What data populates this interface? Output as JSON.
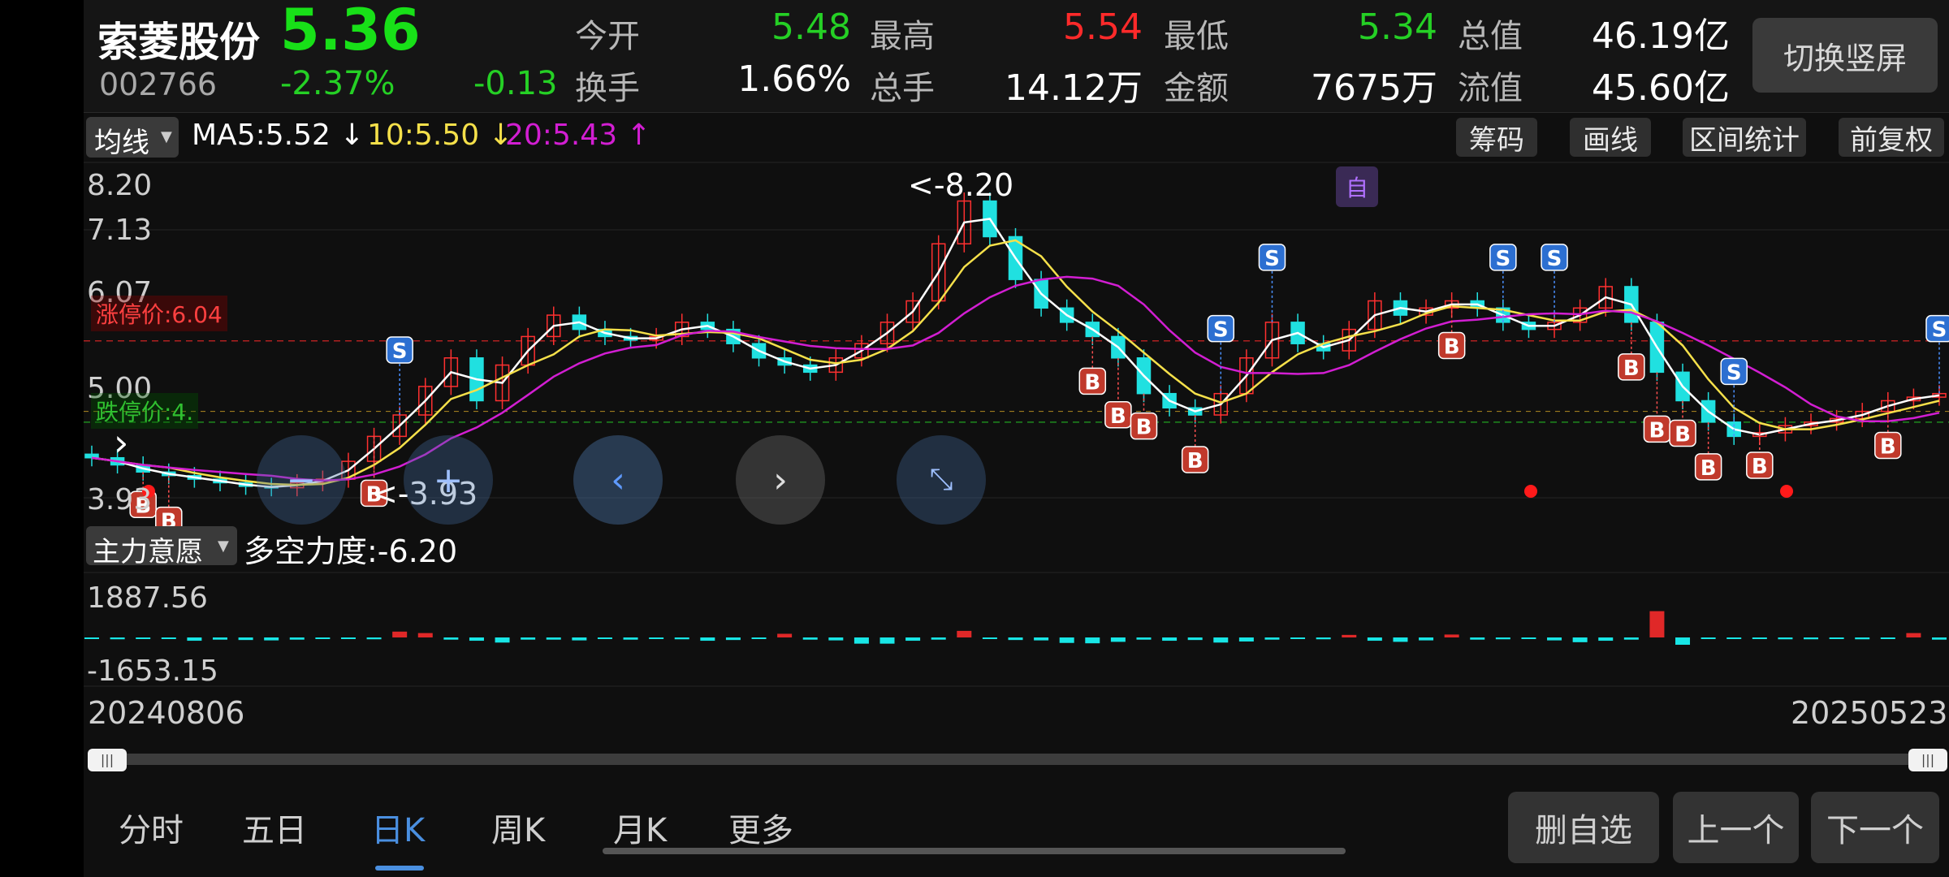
{
  "header": {
    "stock_name": "索菱股份",
    "price": "5.36",
    "code": "002766",
    "change_pct": "-2.37%",
    "change": "-0.13",
    "stats": [
      {
        "label": "今开",
        "value": "5.48",
        "color": "#25d025"
      },
      {
        "label": "最高",
        "value": "5.54",
        "color": "#ff2a2a"
      },
      {
        "label": "最低",
        "value": "5.34",
        "color": "#25d025"
      },
      {
        "label": "总值",
        "value": "46.19亿",
        "color": "#ffffff"
      },
      {
        "label": "换手",
        "value": "1.66%",
        "color": "#ffffff"
      },
      {
        "label": "总手",
        "value": "14.12万",
        "color": "#ffffff"
      },
      {
        "label": "金额",
        "value": "7675万",
        "color": "#ffffff"
      },
      {
        "label": "流值",
        "value": "45.60亿",
        "color": "#ffffff"
      }
    ],
    "switch_button": "切换竖屏"
  },
  "ma_bar": {
    "selector": "均线",
    "ma5": "MA5:5.52",
    "ma10": "10:5.50",
    "ma20": "20:5.43",
    "ma5_color": "#ffffff",
    "ma10_color": "#f5e04a",
    "ma20_color": "#d21ed2",
    "ma5_trend": "down-arrow",
    "ma10_trend": "down-arrow",
    "ma20_trend": "up-arrow"
  },
  "tools": [
    "筹码",
    "画线",
    "区间统计",
    "前复权"
  ],
  "price_axis": [
    "8.20",
    "7.13",
    "6.07",
    "5.00",
    "3.93"
  ],
  "limit_up_label": "涨停价:6.04",
  "limit_down_label": "跌停价:4.",
  "high_marker": "8.20",
  "low_marker": "3.93",
  "custom_marker": "自",
  "indicator": {
    "selector": "主力意愿",
    "title": "多空力度:-6.20",
    "axis_top": "1887.56",
    "axis_bottom": "-1653.15"
  },
  "date_start": "20240806",
  "date_end": "20250523",
  "nav_tabs": [
    "分时",
    "五日",
    "日K",
    "周K",
    "月K",
    "更多"
  ],
  "active_tab": 2,
  "bottom_buttons": [
    "删自选",
    "上一个",
    "下一个"
  ],
  "chart_data": {
    "type": "candlestick",
    "date_range": [
      "20240806",
      "20250523"
    ],
    "ylim": [
      3.93,
      8.2
    ],
    "y_ticks": [
      8.2,
      7.13,
      6.07,
      5.0,
      3.93
    ],
    "limit_up": 6.04,
    "ma": {
      "MA5": 5.52,
      "MA10": 5.5,
      "MA20": 5.43
    },
    "close": [
      4.4,
      4.3,
      4.2,
      4.15,
      4.1,
      4.05,
      4.0,
      3.98,
      4.05,
      4.1,
      4.35,
      4.7,
      5.0,
      5.4,
      5.8,
      5.2,
      5.7,
      6.1,
      6.4,
      6.2,
      6.1,
      6.05,
      6.1,
      6.3,
      6.2,
      6.0,
      5.8,
      5.7,
      5.6,
      5.8,
      6.0,
      6.3,
      6.6,
      7.4,
      8.0,
      7.5,
      6.9,
      6.5,
      6.3,
      6.1,
      5.8,
      5.3,
      5.1,
      5.0,
      5.3,
      5.8,
      6.3,
      6.0,
      5.9,
      6.2,
      6.6,
      6.4,
      6.5,
      6.6,
      6.5,
      6.3,
      6.2,
      6.3,
      6.5,
      6.8,
      6.3,
      5.6,
      5.2,
      4.9,
      4.7,
      4.75,
      4.85,
      4.9,
      4.95,
      5.05,
      5.2,
      5.25,
      5.3
    ],
    "indicator_values": [
      -40,
      -50,
      -30,
      -20,
      -90,
      -60,
      -70,
      -80,
      -60,
      -40,
      -30,
      -50,
      160,
      120,
      -60,
      -90,
      -140,
      -60,
      -60,
      -80,
      -30,
      -60,
      -40,
      -50,
      -90,
      -70,
      -40,
      100,
      -60,
      -80,
      -170,
      -170,
      -90,
      -60,
      180,
      -40,
      -70,
      -80,
      -150,
      -160,
      -120,
      -60,
      -90,
      -70,
      -140,
      -110,
      -60,
      -40,
      -50,
      70,
      -90,
      -120,
      -80,
      80,
      -60,
      -50,
      -40,
      -80,
      -130,
      -90,
      -60,
      720,
      -200,
      -40,
      -30,
      -40,
      -50,
      -50,
      -40,
      -50,
      -40,
      120,
      -60
    ]
  }
}
